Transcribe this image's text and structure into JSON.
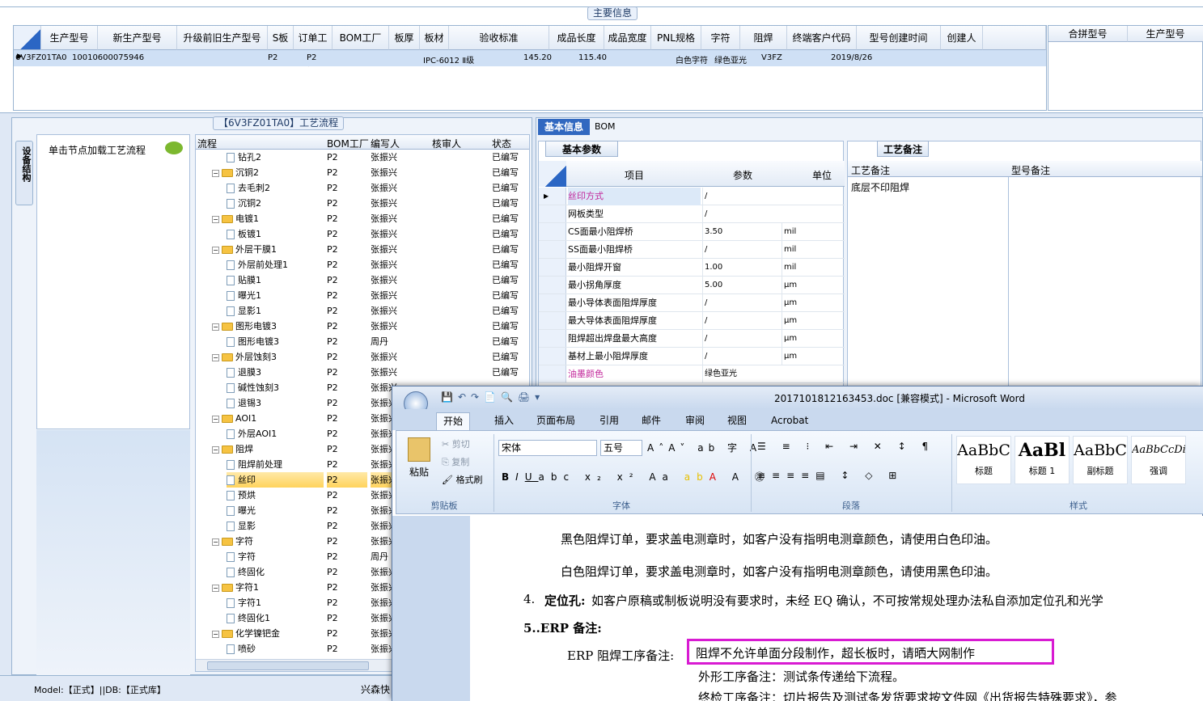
{
  "main_info": {
    "title": "主要信息",
    "columns": [
      "生产型号",
      "新生产型号",
      "升级前旧生产型号",
      "S板",
      "订单工厂",
      "BOM工厂",
      "板厚",
      "板材",
      "验收标准",
      "成品长度",
      "成品宽度",
      "PNL规格",
      "字符",
      "阻焊",
      "终端客户代码",
      "型号创建时间",
      "创建人"
    ],
    "row": [
      "6V3FZ01TA0",
      "10010600075946",
      "",
      "",
      "P2",
      "P2",
      "",
      "",
      "IPC-6012 Ⅱ级",
      "145.20",
      "115.40",
      "",
      "白色字符",
      "绿色亚光",
      "V3FZ",
      "2019/8/26",
      ""
    ],
    "right_columns": [
      "合拼型号",
      "生产型号"
    ]
  },
  "process": {
    "title": "【6V3FZ01TA0】工艺流程",
    "side_tab": "设备结构",
    "hint": "单击节点加载工艺流程",
    "columns": [
      "流程",
      "BOM工厂",
      "编写人",
      "核审人",
      "状态"
    ],
    "rows": [
      {
        "name": "钻孔2",
        "lvl": 2,
        "f": "P2",
        "w": "张振兴",
        "s": "已编写"
      },
      {
        "name": "沉铜2",
        "lvl": 1,
        "f": "P2",
        "w": "张振兴",
        "s": "已编写"
      },
      {
        "name": "去毛刺2",
        "lvl": 2,
        "f": "P2",
        "w": "张振兴",
        "s": "已编写"
      },
      {
        "name": "沉铜2",
        "lvl": 2,
        "f": "P2",
        "w": "张振兴",
        "s": "已编写"
      },
      {
        "name": "电镀1",
        "lvl": 1,
        "f": "P2",
        "w": "张振兴",
        "s": "已编写"
      },
      {
        "name": "板镀1",
        "lvl": 2,
        "f": "P2",
        "w": "张振兴",
        "s": "已编写"
      },
      {
        "name": "外层干膜1",
        "lvl": 1,
        "f": "P2",
        "w": "张振兴",
        "s": "已编写"
      },
      {
        "name": "外层前处理1",
        "lvl": 2,
        "f": "P2",
        "w": "张振兴",
        "s": "已编写"
      },
      {
        "name": "贴膜1",
        "lvl": 2,
        "f": "P2",
        "w": "张振兴",
        "s": "已编写"
      },
      {
        "name": "曝光1",
        "lvl": 2,
        "f": "P2",
        "w": "张振兴",
        "s": "已编写"
      },
      {
        "name": "显影1",
        "lvl": 2,
        "f": "P2",
        "w": "张振兴",
        "s": "已编写"
      },
      {
        "name": "图形电镀3",
        "lvl": 1,
        "f": "P2",
        "w": "张振兴",
        "s": "已编写"
      },
      {
        "name": "图形电镀3",
        "lvl": 2,
        "f": "P2",
        "w": "周丹",
        "s": "已编写"
      },
      {
        "name": "外层蚀刻3",
        "lvl": 1,
        "f": "P2",
        "w": "张振兴",
        "s": "已编写"
      },
      {
        "name": "退膜3",
        "lvl": 2,
        "f": "P2",
        "w": "张振兴",
        "s": "已编写"
      },
      {
        "name": "碱性蚀刻3",
        "lvl": 2,
        "f": "P2",
        "w": "张振兴",
        "s": ""
      },
      {
        "name": "退锡3",
        "lvl": 2,
        "f": "P2",
        "w": "张振兴",
        "s": ""
      },
      {
        "name": "AOI1",
        "lvl": 1,
        "f": "P2",
        "w": "张振兴",
        "s": ""
      },
      {
        "name": "外层AOI1",
        "lvl": 2,
        "f": "P2",
        "w": "张振兴",
        "s": ""
      },
      {
        "name": "阻焊",
        "lvl": 1,
        "f": "P2",
        "w": "张振兴",
        "s": ""
      },
      {
        "name": "阻焊前处理",
        "lvl": 2,
        "f": "P2",
        "w": "张振兴",
        "s": ""
      },
      {
        "name": "丝印",
        "lvl": 2,
        "f": "P2",
        "w": "张振兴",
        "s": "",
        "sel": true
      },
      {
        "name": "预烘",
        "lvl": 2,
        "f": "P2",
        "w": "张振兴",
        "s": ""
      },
      {
        "name": "曝光",
        "lvl": 2,
        "f": "P2",
        "w": "张振兴",
        "s": ""
      },
      {
        "name": "显影",
        "lvl": 2,
        "f": "P2",
        "w": "张振兴",
        "s": ""
      },
      {
        "name": "字符",
        "lvl": 1,
        "f": "P2",
        "w": "张振兴",
        "s": ""
      },
      {
        "name": "字符",
        "lvl": 2,
        "f": "P2",
        "w": "周丹",
        "s": ""
      },
      {
        "name": "终固化",
        "lvl": 2,
        "f": "P2",
        "w": "张振兴",
        "s": ""
      },
      {
        "name": "字符1",
        "lvl": 1,
        "f": "P2",
        "w": "张振兴",
        "s": ""
      },
      {
        "name": "字符1",
        "lvl": 2,
        "f": "P2",
        "w": "张振兴",
        "s": ""
      },
      {
        "name": "终固化1",
        "lvl": 2,
        "f": "P2",
        "w": "张振兴",
        "s": ""
      },
      {
        "name": "化学镍钯金",
        "lvl": 1,
        "f": "P2",
        "w": "张振兴",
        "s": ""
      },
      {
        "name": "喷砂",
        "lvl": 2,
        "f": "P2",
        "w": "张振兴",
        "s": ""
      }
    ]
  },
  "info_tabs": [
    "基本信息",
    "BOM"
  ],
  "params": {
    "tab": "基本参数",
    "columns": [
      "项目",
      "参数",
      "单位"
    ],
    "rows": [
      {
        "item": "丝印方式",
        "val": "/",
        "unit": "",
        "pink": true
      },
      {
        "item": "网板类型",
        "val": "/",
        "unit": ""
      },
      {
        "item": "CS面最小阻焊桥",
        "val": "3.50",
        "unit": "mil"
      },
      {
        "item": "SS面最小阻焊桥",
        "val": "/",
        "unit": "mil"
      },
      {
        "item": "最小阻焊开窗",
        "val": "1.00",
        "unit": "mil"
      },
      {
        "item": "最小拐角厚度",
        "val": "5.00",
        "unit": "μm"
      },
      {
        "item": "最小导体表面阻焊厚度",
        "val": "/",
        "unit": "μm"
      },
      {
        "item": "最大导体表面阻焊厚度",
        "val": "/",
        "unit": "μm"
      },
      {
        "item": "阻焊超出焊盘最大高度",
        "val": "/",
        "unit": "μm"
      },
      {
        "item": "基材上最小阻焊厚度",
        "val": "/",
        "unit": "μm"
      },
      {
        "item": "油墨颜色",
        "val": "绿色亚光",
        "unit": "",
        "pink": true
      }
    ]
  },
  "notes": {
    "tab": "工艺备注",
    "col1": "工艺备注",
    "col2": "型号备注",
    "text": "底层不印阻焊"
  },
  "status": {
    "text": "Model:【正式】||DB:【正式库】",
    "company": "兴森快"
  },
  "word": {
    "title": "2017101812163453.doc [兼容模式] - Microsoft Word",
    "tabs": [
      "开始",
      "插入",
      "页面布局",
      "引用",
      "邮件",
      "审阅",
      "视图",
      "Acrobat"
    ],
    "clipboard": {
      "paste": "粘贴",
      "cut": "剪切",
      "copy": "复制",
      "painter": "格式刷",
      "group": "剪贴板"
    },
    "font": {
      "name": "宋体",
      "size": "五号",
      "group": "字体"
    },
    "para_group": "段落",
    "styles_group": "样式",
    "styles": [
      {
        "sample": "AaBbC",
        "name": "标题"
      },
      {
        "sample": "AaBl",
        "name": "标题 1"
      },
      {
        "sample": "AaBbC",
        "name": "副标题"
      },
      {
        "sample": "AaBbCcDi",
        "name": "强调"
      }
    ],
    "body": [
      "黑色阻焊订单，要求盖电测章时，如客户没有指明电测章颜色，请使用白色印油。",
      "白色阻焊订单，要求盖电测章时，如客户没有指明电测章颜色，请使用黑色印油。",
      "4.",
      "定位孔:",
      "如客户原稿或制板说明没有要求时，未经 EQ 确认，不可按常规处理办法私自添加定位孔和光学",
      "5..ERP 备注:",
      "ERP 阻焊工序备注:",
      "阻焊不允许单面分段制作，超长板时，请晒大网制作",
      "外形工序备注：测试条传递给下流程。",
      "终检工序备注：切片报告及测试条发货要求按文件网《出货报告特殊要求》，参"
    ]
  }
}
